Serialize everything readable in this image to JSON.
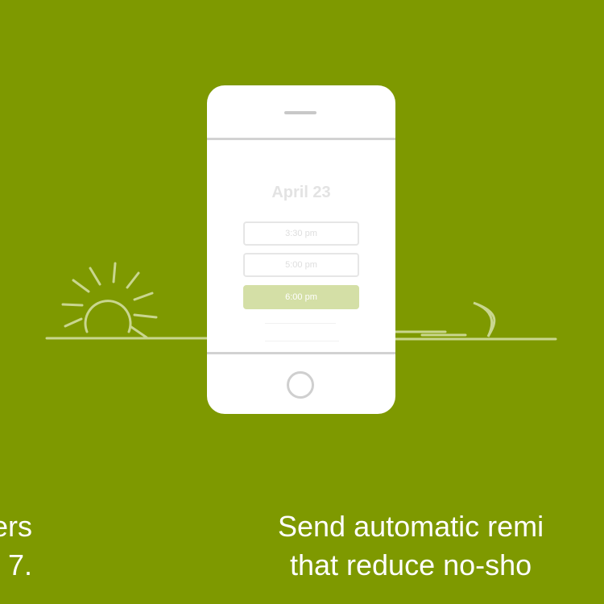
{
  "phone": {
    "date": "April 23",
    "time_slots": [
      "3:30 pm",
      "5:00 pm",
      "6:00 pm"
    ],
    "selected_slot": "6:00 pm"
  },
  "captions": {
    "left": {
      "line1": "ers",
      "line2": "7."
    },
    "right": {
      "line1": "Send automatic remi",
      "line2": "that reduce no-sho"
    }
  },
  "colors": {
    "background": "#7e9900",
    "line_art": "#c9d68f",
    "selected_slot": "#d4dfa6"
  },
  "icons": [
    "sun-icon",
    "moon-icon"
  ]
}
